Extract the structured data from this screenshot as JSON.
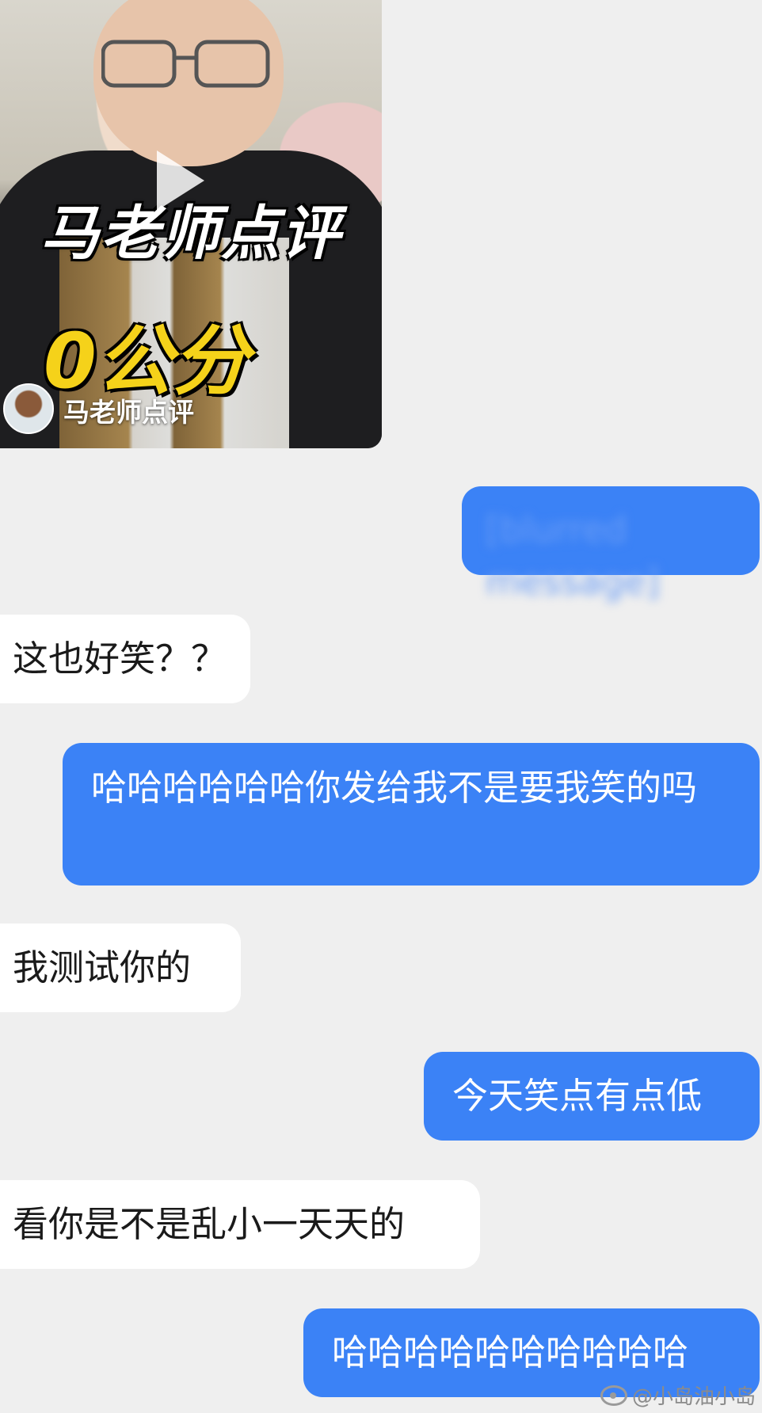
{
  "video": {
    "title_overlay": "马老师点评",
    "score_overlay": "0公分",
    "channel": "马老师点评"
  },
  "messages": [
    {
      "side": "out",
      "text": "[blurred message]",
      "blurred": true
    },
    {
      "side": "in",
      "text": "这也好笑？？"
    },
    {
      "side": "out",
      "text": "哈哈哈哈哈哈你发给我不是要我笑的吗"
    },
    {
      "side": "in",
      "text": "我测试你的"
    },
    {
      "side": "out",
      "text": "今天笑点有点低"
    },
    {
      "side": "in",
      "text": "看你是不是乱小一天天的"
    },
    {
      "side": "out",
      "text": "哈哈哈哈哈哈哈哈哈哈"
    }
  ],
  "watermark": "@小岛油小岛",
  "colors": {
    "outgoing": "#3b82f6",
    "incoming": "#ffffff",
    "background": "#efefef"
  }
}
